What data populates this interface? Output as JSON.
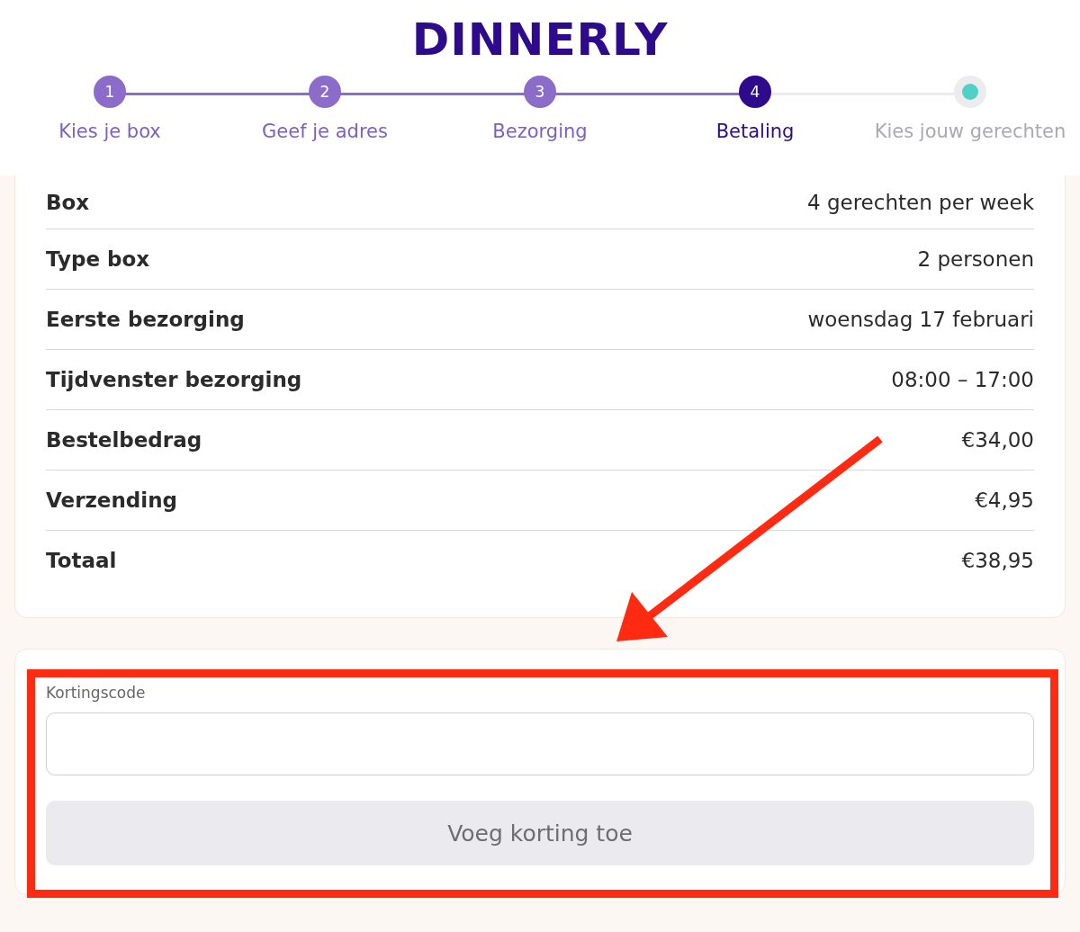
{
  "logo": "DINNERLY",
  "steps": [
    {
      "number": "1",
      "label": "Kies je box",
      "done": true,
      "selected": false
    },
    {
      "number": "2",
      "label": "Geef je adres",
      "done": true,
      "selected": false
    },
    {
      "number": "3",
      "label": "Bezorging",
      "done": true,
      "selected": false
    },
    {
      "number": "4",
      "label": "Betaling",
      "done": false,
      "selected": true
    },
    {
      "label": "Kies jouw gerechten",
      "done": false,
      "selected": false
    }
  ],
  "summary": [
    {
      "label": "Box",
      "value": "4 gerechten per week"
    },
    {
      "label": "Type box",
      "value": "2 personen"
    },
    {
      "label": "Eerste bezorging",
      "value": "woensdag 17 februari"
    },
    {
      "label": "Tijdvenster bezorging",
      "value": "08:00 – 17:00"
    },
    {
      "label": "Bestelbedrag",
      "value": "€34,00"
    },
    {
      "label": "Verzending",
      "value": "€4,95"
    },
    {
      "label": "Totaal",
      "value": "€38,95"
    }
  ],
  "discount": {
    "label": "Kortingscode",
    "button": "Voeg korting toe"
  }
}
